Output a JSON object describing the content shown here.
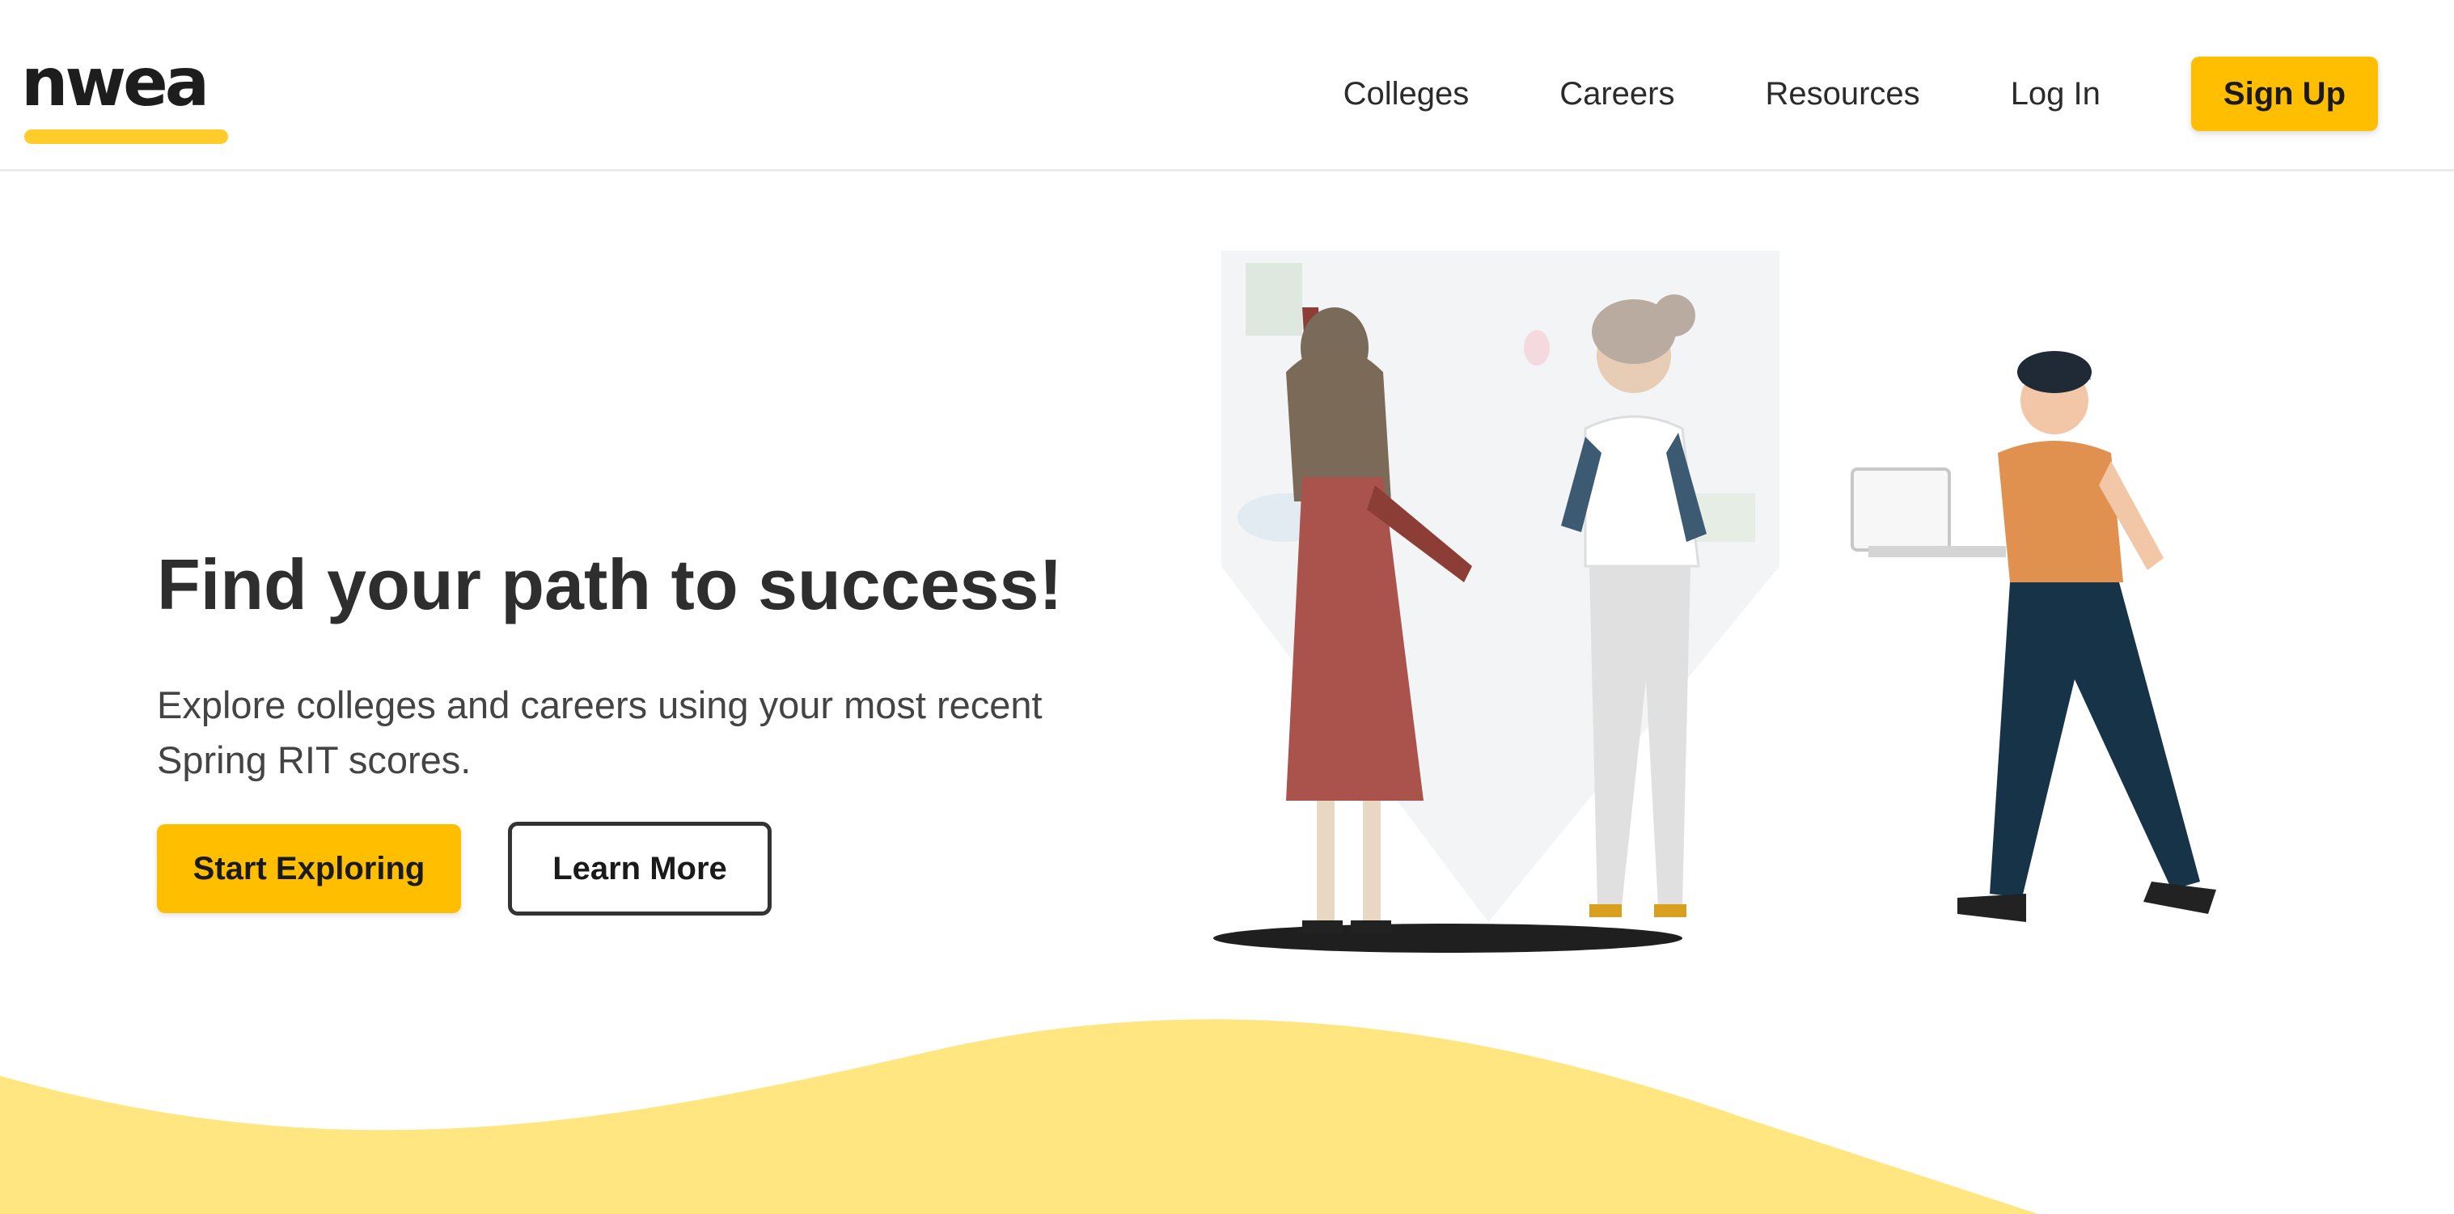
{
  "header": {
    "logo_text": "nwea",
    "nav": [
      {
        "label": "Colleges"
      },
      {
        "label": "Careers"
      },
      {
        "label": "Resources"
      },
      {
        "label": "Log In"
      }
    ],
    "signup_label": "Sign Up"
  },
  "hero": {
    "title": "Find your path to success!",
    "subtitle": "Explore colleges and careers using your most recent Spring RIT scores.",
    "primary_button": "Start Exploring",
    "secondary_button": "Learn More"
  },
  "colors": {
    "accent": "#ffbf00",
    "wave": "#ffe680",
    "logo_underline": "#ffcc29"
  },
  "illustration": {
    "figures": [
      "woman-red-dress",
      "woman-white-top",
      "man-with-laptop"
    ]
  }
}
